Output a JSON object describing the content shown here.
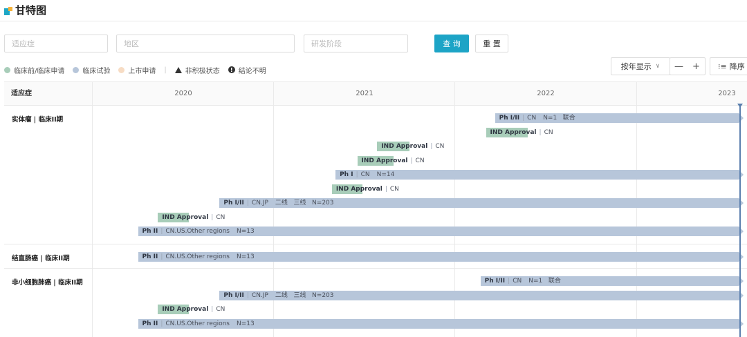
{
  "header": {
    "title": "甘特图"
  },
  "filters": {
    "indication_placeholder": "适应症",
    "region_placeholder": "地区",
    "phase_placeholder": "研发阶段",
    "query_label": "查 询",
    "reset_label": "重 置"
  },
  "legend": {
    "preclinical": "临床前/临床申请",
    "clinical": "临床试验",
    "market": "上市申请",
    "separator": "|",
    "inactive": "非积极状态",
    "unclear": "结论不明",
    "colors": {
      "preclinical": "#a8cdb9",
      "clinical": "#b7c6da",
      "market": "#f7dcc4"
    }
  },
  "toolbar": {
    "view_mode": "按年显示",
    "zoom_out": "—",
    "zoom_in": "+",
    "sort": "降序"
  },
  "table": {
    "first_col_header": "适应症",
    "years": [
      "2020",
      "2021",
      "2022",
      "2023"
    ],
    "groups": [
      {
        "label": "实体瘤 | 临床II期",
        "bars": [
          {
            "phase": "Ph I/II",
            "region": "CN",
            "detail": "N=1   联合",
            "type": "trial",
            "start": 2022.72,
            "end": null
          },
          {
            "phase": "IND Approval",
            "region": "CN",
            "detail": "",
            "type": "ind",
            "start": 2022.67,
            "end": 2022.9
          },
          {
            "phase": "IND Approval",
            "region": "CN",
            "detail": "",
            "type": "ind",
            "start": 2022.07,
            "end": 2022.25
          },
          {
            "phase": "IND Approval",
            "region": "CN",
            "detail": "",
            "type": "ind",
            "start": 2021.96,
            "end": 2022.16
          },
          {
            "phase": "Ph I",
            "region": "CN",
            "detail": "N=14",
            "type": "trial",
            "start": 2021.84,
            "end": null
          },
          {
            "phase": "IND Approval",
            "region": "CN",
            "detail": "",
            "type": "ind",
            "start": 2021.82,
            "end": 2021.99
          },
          {
            "phase": "Ph I/II",
            "region": "CN.JP",
            "detail": "二线   三线   N=203",
            "type": "trial",
            "start": 2021.2,
            "end": null
          },
          {
            "phase": "IND Approval",
            "region": "CN",
            "detail": "",
            "type": "ind",
            "start": 2020.86,
            "end": 2021.03
          },
          {
            "phase": "Ph II",
            "region": "CN.US.Other regions",
            "detail": "N=13",
            "type": "trial",
            "start": 2020.75,
            "end": null
          }
        ]
      },
      {
        "label": "结直肠癌 | 临床II期",
        "bars": [
          {
            "phase": "Ph II",
            "region": "CN.US.Other regions",
            "detail": "N=13",
            "type": "trial",
            "start": 2020.75,
            "end": null
          }
        ]
      },
      {
        "label": "非小细胞肺癌 | 临床II期",
        "bars": [
          {
            "phase": "Ph I/II",
            "region": "CN",
            "detail": "N=1   联合",
            "type": "trial",
            "start": 2022.64,
            "end": null
          },
          {
            "phase": "Ph I/II",
            "region": "CN.JP",
            "detail": "二线   三线   N=203",
            "type": "trial",
            "start": 2021.2,
            "end": null
          },
          {
            "phase": "IND Approval",
            "region": "CN",
            "detail": "",
            "type": "ind",
            "start": 2020.86,
            "end": 2021.03
          },
          {
            "phase": "Ph II",
            "region": "CN.US.Other regions",
            "detail": "N=13",
            "type": "trial",
            "start": 2020.75,
            "end": null
          }
        ]
      }
    ]
  }
}
